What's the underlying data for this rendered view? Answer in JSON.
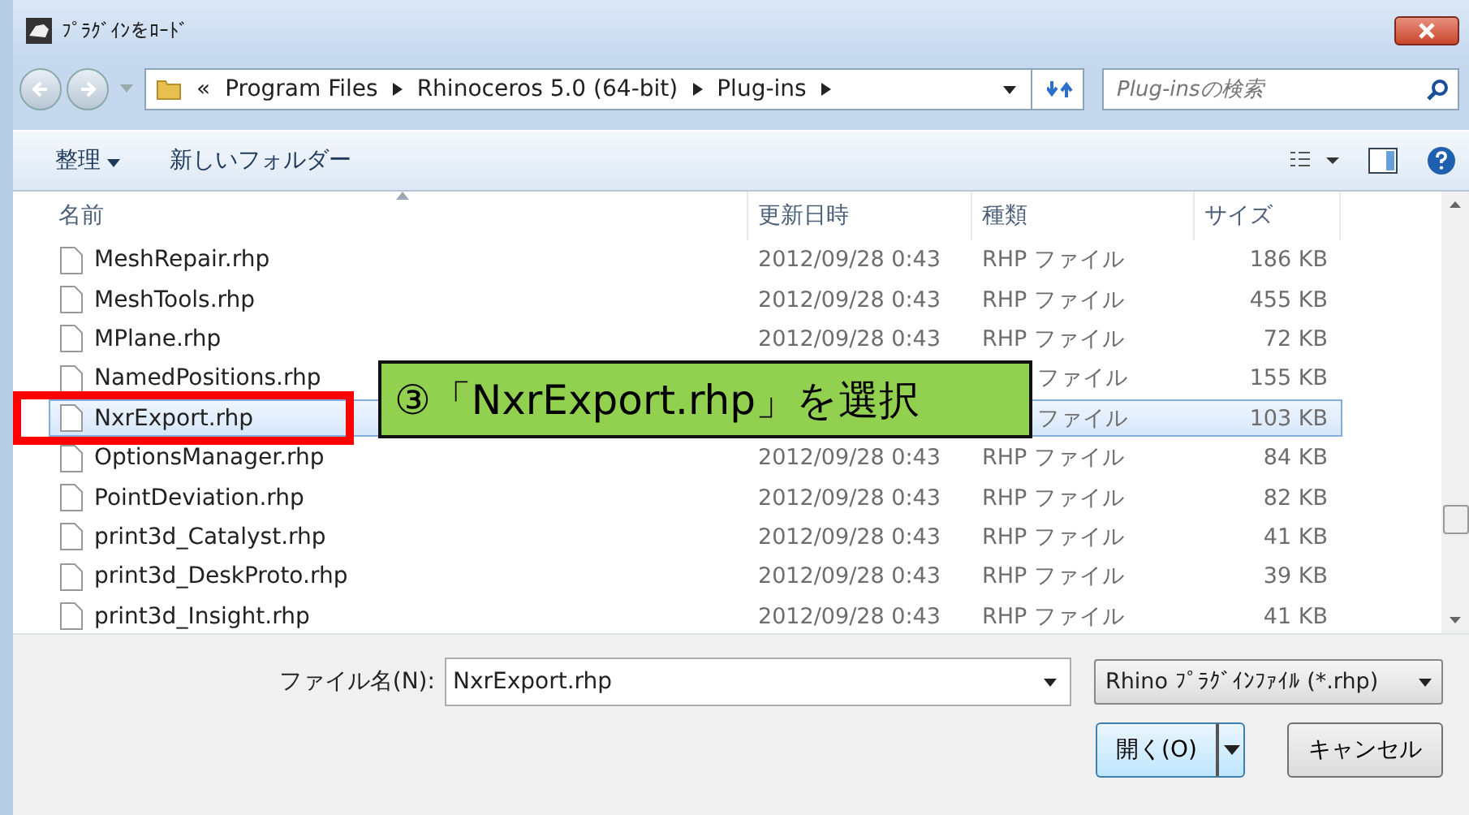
{
  "window": {
    "title": "ﾌﾟﾗｸﾞｲﾝをﾛｰﾄﾞ"
  },
  "address": {
    "overflow": "«",
    "crumbs": [
      "Program Files",
      "Rhinoceros 5.0 (64-bit)",
      "Plug-ins"
    ]
  },
  "search": {
    "placeholder": "Plug-insの検索"
  },
  "toolbar": {
    "organize": "整理",
    "new_folder": "新しいフォルダー"
  },
  "table": {
    "columns": [
      "名前",
      "更新日時",
      "種類",
      "サイズ"
    ],
    "rows": [
      {
        "name": "MeshRepair.rhp",
        "date": "2012/09/28 0:43",
        "type": "RHP ファイル",
        "size": "186 KB",
        "selected": false
      },
      {
        "name": "MeshTools.rhp",
        "date": "2012/09/28 0:43",
        "type": "RHP ファイル",
        "size": "455 KB",
        "selected": false
      },
      {
        "name": "MPlane.rhp",
        "date": "2012/09/28 0:43",
        "type": "RHP ファイル",
        "size": "72 KB",
        "selected": false
      },
      {
        "name": "NamedPositions.rhp",
        "type": "ファイル",
        "size": "155 KB",
        "selected": false
      },
      {
        "name": "NxrExport.rhp",
        "type": "ファイル",
        "size": "103 KB",
        "selected": true
      },
      {
        "name": "OptionsManager.rhp",
        "date": "2012/09/28 0:43",
        "type": "RHP ファイル",
        "size": "84 KB",
        "selected": false
      },
      {
        "name": "PointDeviation.rhp",
        "date": "2012/09/28 0:43",
        "type": "RHP ファイル",
        "size": "82 KB",
        "selected": false
      },
      {
        "name": "print3d_Catalyst.rhp",
        "date": "2012/09/28 0:43",
        "type": "RHP ファイル",
        "size": "41 KB",
        "selected": false
      },
      {
        "name": "print3d_DeskProto.rhp",
        "date": "2012/09/28 0:43",
        "type": "RHP ファイル",
        "size": "39 KB",
        "selected": false
      },
      {
        "name": "print3d_Insight.rhp",
        "date": "2012/09/28 0:43",
        "type": "RHP ファイル",
        "size": "41 KB",
        "selected": false
      }
    ]
  },
  "filename": {
    "label": "ファイル名(N):",
    "value": "NxrExport.rhp"
  },
  "filter": {
    "value": "Rhino ﾌﾟﾗｸﾞｲﾝﾌｧｲﾙ (*.rhp)"
  },
  "buttons": {
    "open": "開く(O)",
    "cancel": "キャンセル"
  },
  "callout": {
    "text": "③「NxrExport.rhp」を選択"
  }
}
